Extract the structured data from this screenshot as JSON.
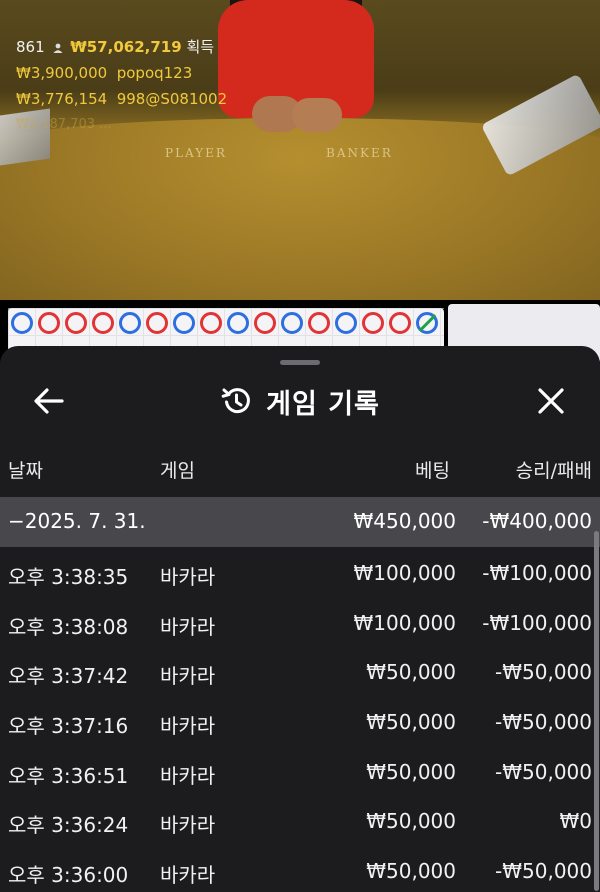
{
  "overlay": {
    "player_count": "861",
    "total_amount": "₩57,062,719",
    "total_suffix": "획득",
    "winners": [
      {
        "amount": "₩3,900,000",
        "name": "popoq123"
      },
      {
        "amount": "₩3,776,154",
        "name": "998@S081002"
      }
    ],
    "faded_line": "₩2,187,703 ..."
  },
  "table_labels": {
    "player": "PLAYER",
    "banker": "BANKER"
  },
  "history": {
    "title": "게임 기록",
    "back_icon": "arrow-left-icon",
    "history_icon": "history-clock-icon",
    "close_icon": "close-icon",
    "columns": {
      "date": "날짜",
      "game": "게임",
      "bet": "베팅",
      "result": "승리/패배"
    },
    "total": {
      "date": "−2025. 7. 31.",
      "bet": "₩450,000",
      "result": "-₩400,000"
    },
    "rows": [
      {
        "time": "오후 3:38:35",
        "game": "바카라",
        "bet": "₩100,000",
        "result": "-₩100,000"
      },
      {
        "time": "오후 3:38:08",
        "game": "바카라",
        "bet": "₩100,000",
        "result": "-₩100,000"
      },
      {
        "time": "오후 3:37:42",
        "game": "바카라",
        "bet": "₩50,000",
        "result": "-₩50,000"
      },
      {
        "time": "오후 3:37:16",
        "game": "바카라",
        "bet": "₩50,000",
        "result": "-₩50,000"
      },
      {
        "time": "오후 3:36:51",
        "game": "바카라",
        "bet": "₩50,000",
        "result": "-₩50,000"
      },
      {
        "time": "오후 3:36:24",
        "game": "바카라",
        "bet": "₩50,000",
        "result": "₩0"
      },
      {
        "time": "오후 3:36:00",
        "game": "바카라",
        "bet": "₩50,000",
        "result": "-₩50,000"
      }
    ]
  },
  "colors": {
    "sheet_bg": "#1c1c1f",
    "total_row_bg": "#48484c",
    "gold": "#f0c93c",
    "player_blue": "#2d6fe0",
    "banker_red": "#e23434"
  }
}
